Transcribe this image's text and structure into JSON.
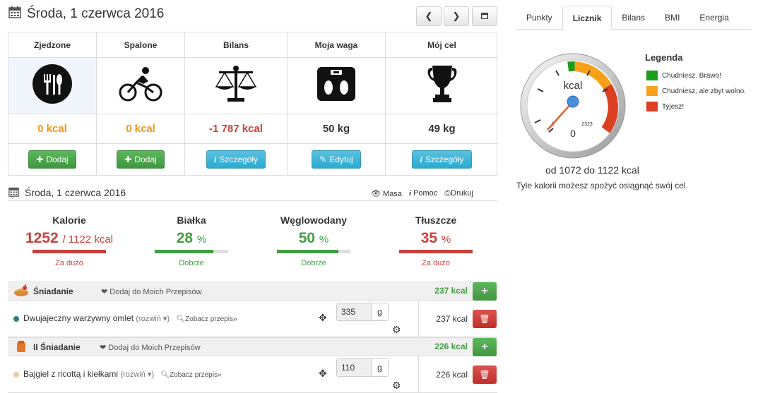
{
  "header": {
    "date": "Środa, 1 czerwca 2016"
  },
  "summary": {
    "columns": [
      {
        "title": "Zjedzone",
        "value": "0 kcal",
        "button": "Dodaj",
        "value_color": "#f0961a"
      },
      {
        "title": "Spalone",
        "value": "0 kcal",
        "button": "Dodaj",
        "value_color": "#f0961a"
      },
      {
        "title": "Bilans",
        "value": "-1 787 kcal",
        "button": "Szczegóły",
        "value_color": "#c9423d"
      },
      {
        "title": "Moja waga",
        "value": "50 kg",
        "button": "Edytuj",
        "value_color": "#333333"
      },
      {
        "title": "Mój cel",
        "value": "49 kg",
        "button": "Szczegóły",
        "value_color": "#333333"
      }
    ]
  },
  "tabs": [
    "Punkty",
    "Licznik",
    "Bilans",
    "BMI",
    "Energia"
  ],
  "tabs_active": "Licznik",
  "gauge": {
    "unit": "kcal",
    "min_label": "0",
    "max_label": "2323",
    "center_value": "0"
  },
  "legend": {
    "title": "Legenda",
    "items": [
      {
        "label": "Chudniesz. Brawo!",
        "color": "#1e9c1e"
      },
      {
        "label": "Chudniesz, ale zbyt wolno.",
        "color": "#f7a11a"
      },
      {
        "label": "Tyjesz!",
        "color": "#dd3f22"
      }
    ]
  },
  "range": {
    "text": "od 1072 do 1122 kcal",
    "sub": "Tyle kalorii możesz spożyć osiągnąć swój cel."
  },
  "section2": {
    "date": "Środa, 1 czerwca 2016",
    "links": [
      "Masa",
      "Pomoc",
      "Drukuj"
    ]
  },
  "macros": [
    {
      "title": "Kalorie",
      "value": "1252",
      "suffix": "/ 1122 kcal",
      "status": "Za dużo",
      "color": "#c9423d",
      "fill_pct": 100
    },
    {
      "title": "Białka",
      "value": "28",
      "suffix": "%",
      "status": "Dobrze",
      "color": "#449d44",
      "fill_pct": 80
    },
    {
      "title": "Węglowodany",
      "value": "50",
      "suffix": "%",
      "status": "Dobrze",
      "color": "#449d44",
      "fill_pct": 84
    },
    {
      "title": "Tłuszcze",
      "value": "35",
      "suffix": "%",
      "status": "Za dużo",
      "color": "#c9423d",
      "fill_pct": 100
    }
  ],
  "meals": [
    {
      "name": "Śniadanie",
      "fav": "Dodaj do Moich Przepisów",
      "kcal": "237 kcal",
      "food": {
        "name": "Dwujajeczny warzywny omlet",
        "expand": "(rozwiń ▾)",
        "recipe": "Zobacz przepis»",
        "qty": "335",
        "unit": "g",
        "kcal": "237 kcal",
        "dot": "#2e7d7d"
      }
    },
    {
      "name": "II Śniadanie",
      "fav": "Dodaj do Moich Przepisów",
      "kcal": "226 kcal",
      "food": {
        "name": "Bajgiel z ricottą i kiełkami",
        "expand": "(rozwiń ▾)",
        "recipe": "Zobacz przepis»",
        "qty": "110",
        "unit": "g",
        "kcal": "226 kcal",
        "dot": "#e8c9a8"
      }
    }
  ]
}
